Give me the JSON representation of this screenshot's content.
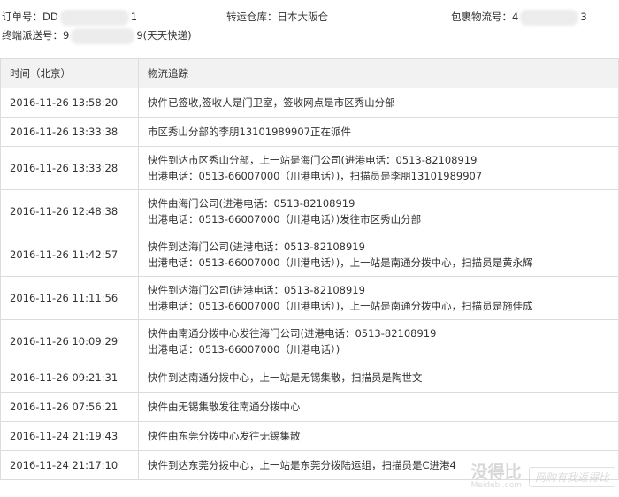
{
  "order": {
    "order_no_label": "订单号：",
    "order_no_prefix": "DD",
    "order_no_suffix": "1",
    "warehouse_label": "转运仓库：",
    "warehouse_value": "日本大阪仓",
    "parcel_no_label": "包裹物流号：",
    "parcel_no_prefix": "4",
    "parcel_no_suffix": "3",
    "final_tracking_label": "终端派送号：",
    "final_tracking_prefix": "9",
    "final_tracking_suffix": "9(天天快递)"
  },
  "table": {
    "headers": [
      "时间（北京）",
      "物流追踪"
    ],
    "rows": [
      {
        "time": "2016-11-26 13:58:20",
        "line1": "快件已签收,签收人是门卫室，签收网点是市区秀山分部",
        "line2": ""
      },
      {
        "time": "2016-11-26 13:33:38",
        "line1": "市区秀山分部的李朋13101989907正在派件",
        "line2": ""
      },
      {
        "time": "2016-11-26 13:33:28",
        "line1": "快件到达市区秀山分部，上一站是海门公司(进港电话：0513-82108919",
        "line2": "出港电话：0513-66007000（川港电话）)，扫描员是李朋13101989907"
      },
      {
        "time": "2016-11-26 12:48:38",
        "line1": "快件由海门公司(进港电话：0513-82108919",
        "line2": "出港电话：0513-66007000（川港电话）)发往市区秀山分部"
      },
      {
        "time": "2016-11-26 11:42:57",
        "line1": "快件到达海门公司(进港电话：0513-82108919",
        "line2": "出港电话：0513-66007000（川港电话）)，上一站是南通分拨中心，扫描员是黄永辉"
      },
      {
        "time": "2016-11-26 11:11:56",
        "line1": "快件到达海门公司(进港电话：0513-82108919",
        "line2": "出港电话：0513-66007000（川港电话）)，上一站是南通分拨中心，扫描员是施佳成"
      },
      {
        "time": "2016-11-26 10:09:29",
        "line1": "快件由南通分拨中心发往海门公司(进港电话：0513-82108919",
        "line2": "出港电话：0513-66007000（川港电话）)"
      },
      {
        "time": "2016-11-26 09:21:31",
        "line1": "快件到达南通分拨中心，上一站是无锡集散，扫描员是陶世文",
        "line2": ""
      },
      {
        "time": "2016-11-26 07:56:21",
        "line1": "快件由无锡集散发往南通分拨中心",
        "line2": ""
      },
      {
        "time": "2016-11-24 21:19:43",
        "line1": "快件由东莞分拨中心发往无锡集散",
        "line2": ""
      },
      {
        "time": "2016-11-24 21:17:10",
        "line1": "快件到达东莞分拨中心，上一站是东莞分拨陆运组，扫描员是C进港4",
        "line2": ""
      }
    ]
  },
  "watermark": {
    "logo": "没得比",
    "site": "Meidebi.com",
    "slogan": "网购有我返得比"
  }
}
